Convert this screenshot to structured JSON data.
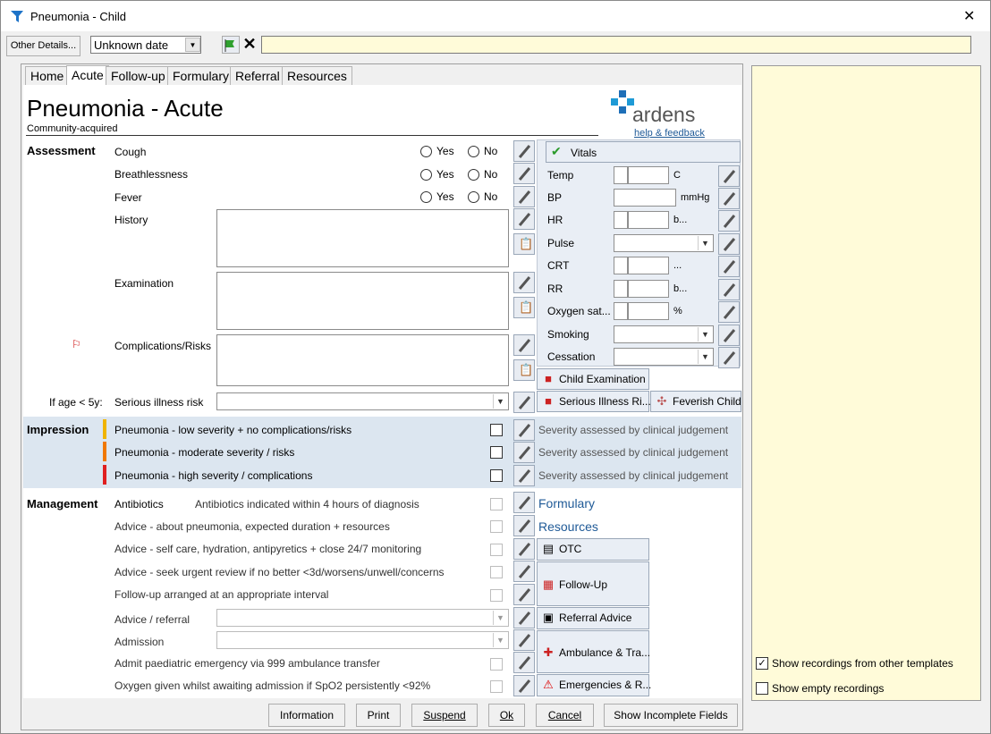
{
  "window": {
    "title": "Pneumonia - Child",
    "close": "✕"
  },
  "toolbar": {
    "other_details": "Other Details...",
    "date_value": "Unknown date",
    "text_value": ""
  },
  "tabs": [
    "Home",
    "Acute",
    "Follow-up",
    "Formulary",
    "Referral",
    "Resources"
  ],
  "header": {
    "title": "Pneumonia - Acute",
    "subtitle": "Community-acquired",
    "logo_text": "ardens",
    "help_link": "help & feedback"
  },
  "assessment": {
    "section": "Assessment",
    "cough": "Cough",
    "breathlessness": "Breathlessness",
    "fever": "Fever",
    "yes": "Yes",
    "no": "No",
    "history": "History",
    "examination": "Examination",
    "complications": "Complications/Risks",
    "if_age": "If age < 5y:",
    "serious_illness": "Serious illness risk"
  },
  "vitals": {
    "title": "Vitals",
    "rows": [
      {
        "label": "Temp",
        "unit": "C"
      },
      {
        "label": "BP",
        "unit": "mmHg"
      },
      {
        "label": "HR",
        "unit": "b..."
      },
      {
        "label": "Pulse",
        "unit": ""
      },
      {
        "label": "CRT",
        "unit": "..."
      },
      {
        "label": "RR",
        "unit": "b..."
      },
      {
        "label": "Oxygen sat...",
        "unit": "%"
      },
      {
        "label": "Smoking",
        "unit": ""
      },
      {
        "label": "Cessation",
        "unit": ""
      }
    ]
  },
  "buttons_side": {
    "child_exam": "Child Examination",
    "serious_illness": "Serious Illness Ri...",
    "feverish": "Feverish Child",
    "otc": "OTC",
    "follow_up": "Follow-Up",
    "referral_advice": "Referral Advice",
    "ambulance": "Ambulance & Tra...",
    "emergencies": "Emergencies & R..."
  },
  "impression": {
    "section": "Impression",
    "rows": [
      {
        "label": "Pneumonia - low severity + no complications/risks",
        "note": "Severity assessed by clinical judgement",
        "color": "#f0b400"
      },
      {
        "label": "Pneumonia - moderate severity / risks",
        "note": "Severity assessed by clinical judgement",
        "color": "#f07800"
      },
      {
        "label": "Pneumonia - high severity / complications",
        "note": "Severity assessed by clinical judgement",
        "color": "#e02020"
      }
    ]
  },
  "management": {
    "section": "Management",
    "antibiotics": "Antibiotics",
    "antibiotics_note": "Antibiotics indicated within 4 hours of diagnosis",
    "advice1": "Advice - about pneumonia, expected duration + resources",
    "advice2": "Advice - self care, hydration, antipyretics + close 24/7 monitoring",
    "advice3": "Advice - seek urgent review if no better <3d/worsens/unwell/concerns",
    "followup": "Follow-up arranged at an appropriate interval",
    "advice_referral": "Advice / referral",
    "admission": "Admission",
    "admit_paed": "Admit paediatric emergency via 999 ambulance transfer",
    "oxygen": "Oxygen given whilst awaiting admission if SpO2 persistently <92%",
    "formulary_link": "Formulary",
    "resources_link": "Resources"
  },
  "bottom": {
    "information": "Information",
    "print": "Print",
    "suspend": "Suspend",
    "ok": "Ok",
    "cancel": "Cancel",
    "show_incomplete": "Show Incomplete Fields"
  },
  "right_panel": {
    "show_other": "Show recordings from other templates",
    "show_empty": "Show empty recordings"
  }
}
